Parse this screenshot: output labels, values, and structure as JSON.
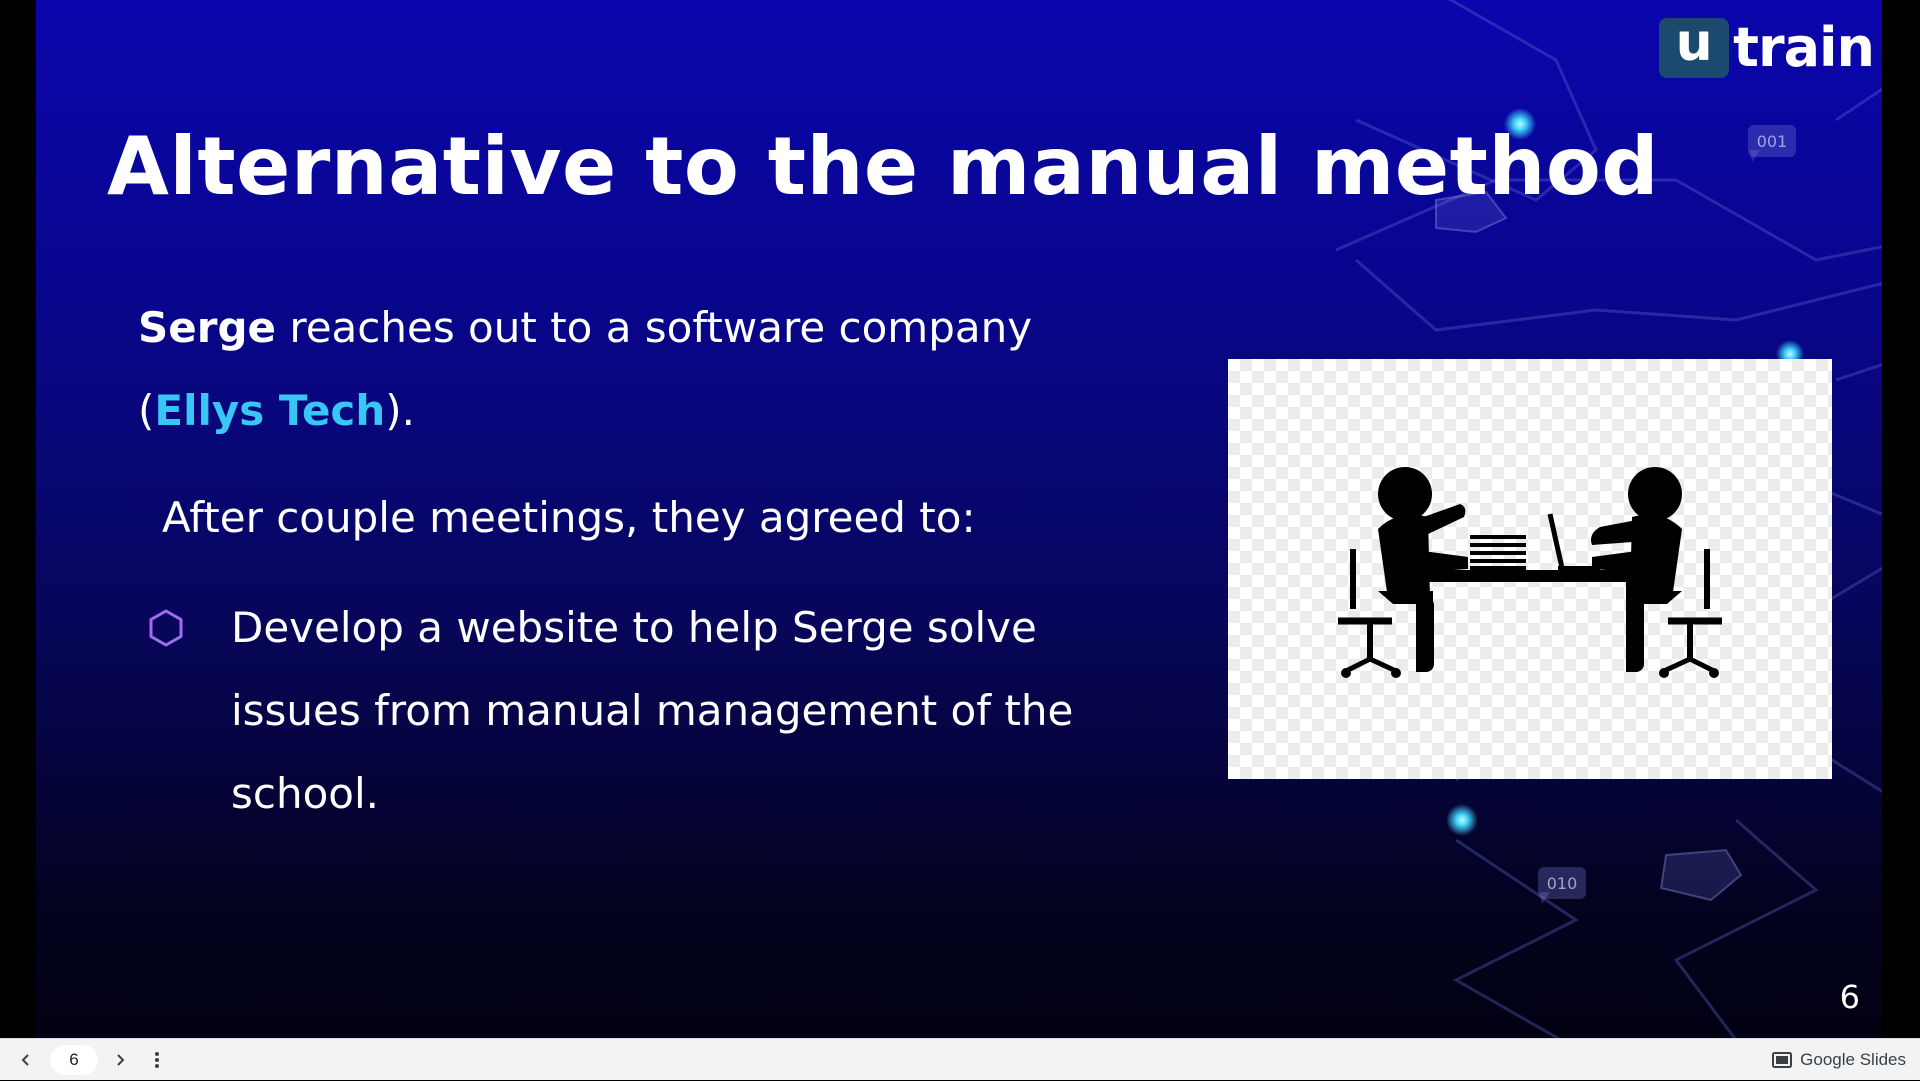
{
  "slide": {
    "logo": {
      "mark": "u",
      "word": "train"
    },
    "title": "Alternative to the manual method",
    "para1": {
      "bold": "Serge",
      "rest": " reaches out to a software company",
      "open": "(",
      "accent": "Ellys Tech",
      "close": ")."
    },
    "para2": "After couple meetings, they agreed to:",
    "bullet": "Develop a website to help Serge solve issues from manual management of the school.",
    "bullet_icon": "hexagon-outline-icon",
    "image_alt": "two people meeting at a table",
    "number": "6",
    "deco_codes": [
      "001",
      "010"
    ],
    "colors": {
      "accent": "#38c6f4",
      "bullet": "#a06cf0",
      "logo_box": "#1b4a6e"
    }
  },
  "toolbar": {
    "page_value": "6",
    "brand_label": "Google Slides"
  }
}
